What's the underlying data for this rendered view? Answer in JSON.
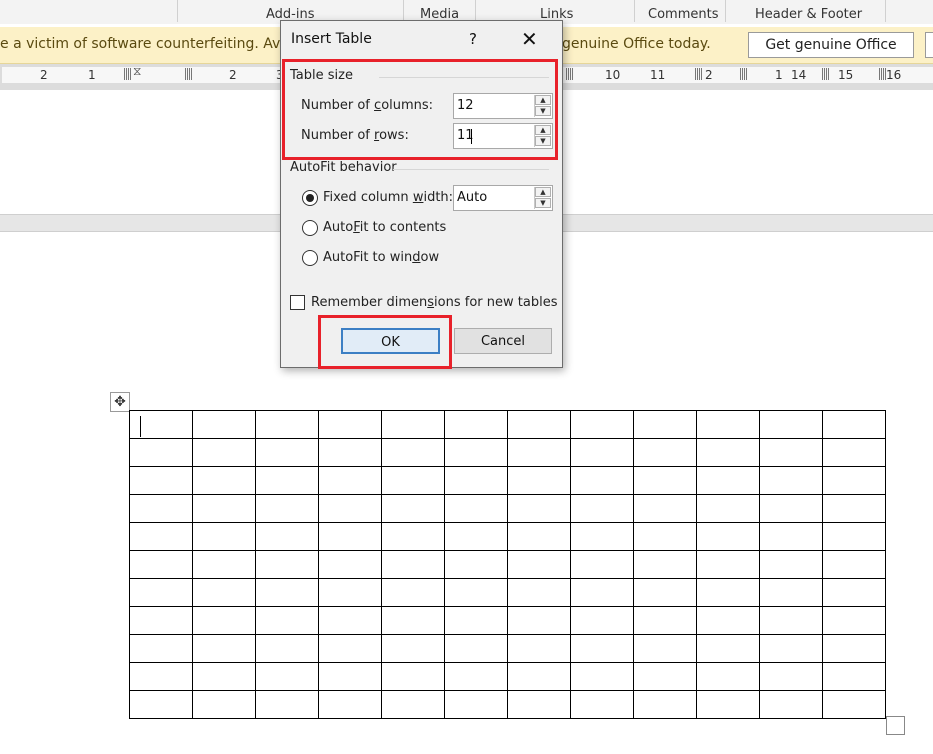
{
  "ribbon_groups": [
    "Add-ins",
    "Media",
    "Links",
    "Comments",
    "Header & Footer"
  ],
  "message_bar": {
    "text_left": "e a victim of software counterfeiting. Avoid",
    "text_right": "genuine Office today.",
    "button": "Get genuine Office"
  },
  "ruler": {
    "ticks": [
      "2",
      "1",
      "2",
      "3",
      "10",
      "11",
      "2",
      "1",
      "14",
      "15",
      "16"
    ]
  },
  "dialog": {
    "title": "Insert Table",
    "help": "?",
    "close": "✕",
    "table_size": {
      "heading": "Table size",
      "columns_label": "Number of columns:",
      "columns_value": "12",
      "rows_label": "Number of rows:",
      "rows_value": "11"
    },
    "autofit": {
      "heading": "AutoFit behavior",
      "fixed_label": "Fixed column width:",
      "fixed_value": "Auto",
      "contents_label": "AutoFit to contents",
      "window_label": "AutoFit to window",
      "selected": "fixed"
    },
    "remember_label": "Remember dimensions for new tables",
    "remember_checked": false,
    "ok_label": "OK",
    "cancel_label": "Cancel"
  },
  "document_table": {
    "columns": 12,
    "rows": 11
  },
  "highlight_color": "#e8212a"
}
